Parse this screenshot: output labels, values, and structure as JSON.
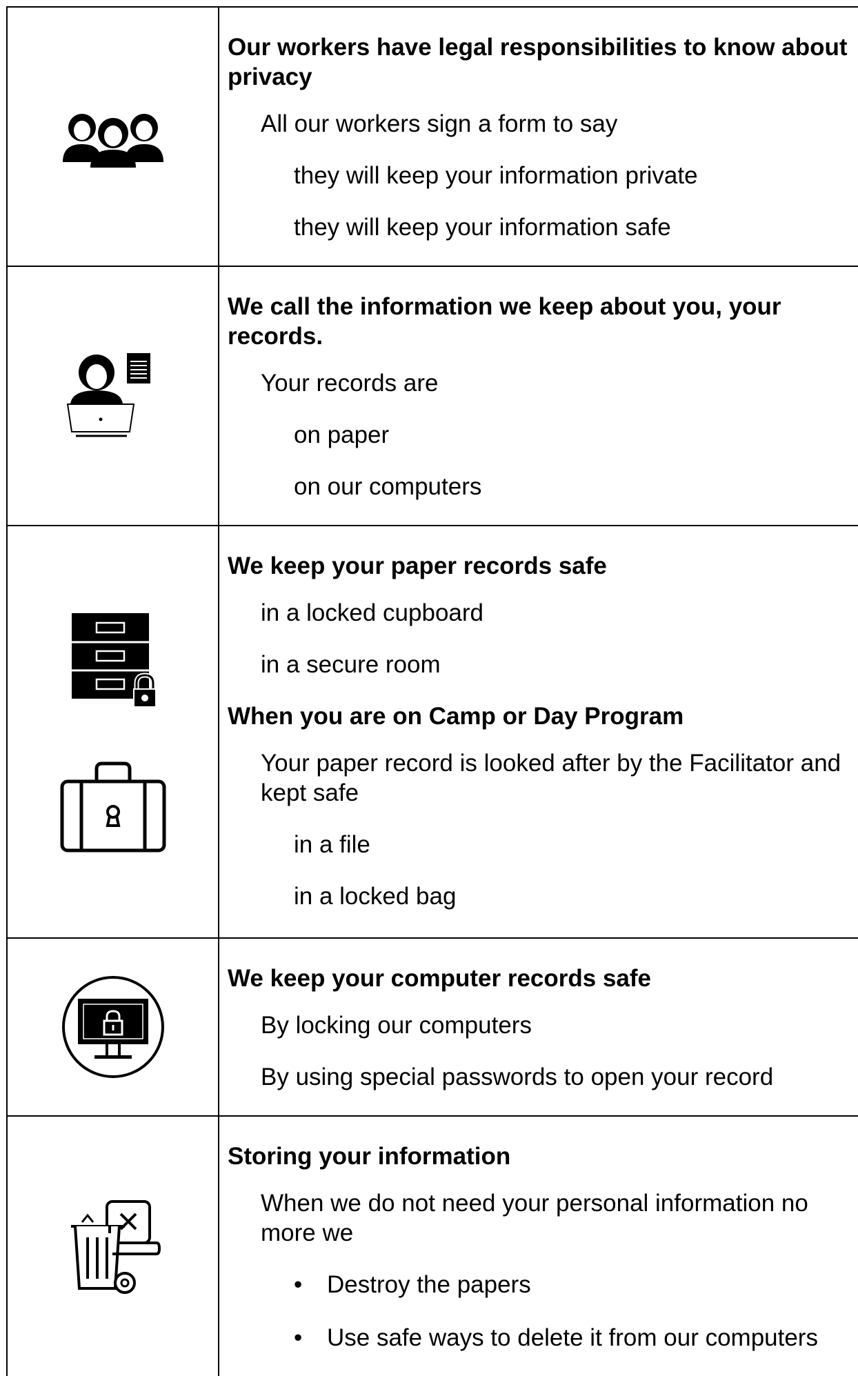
{
  "rows": [
    {
      "icon": "three-people-icon",
      "heading": "Our workers have legal responsibilities to know about privacy",
      "line1": "All our workers sign a form to say",
      "sub1": "they will keep your information private",
      "sub2": "they will keep your information safe"
    },
    {
      "icon": "person-at-laptop-with-document-icon",
      "heading": "We call the information we keep about you, your records.",
      "line1": "Your records are",
      "sub1": "on paper",
      "sub2": "on our computers"
    },
    {
      "icons": [
        "locked-filing-cabinet-icon",
        "locked-suitcase-icon"
      ],
      "heading1": "We keep your paper records safe",
      "line1": "in a locked cupboard",
      "line2": "in a secure room",
      "heading2": "When you are on Camp or Day Program",
      "line3": "Your paper record is looked after by the Facilitator and kept safe",
      "sub1": "in a file",
      "sub2": "in a locked bag"
    },
    {
      "icon": "locked-computer-icon",
      "heading": "We keep your computer records safe",
      "line1": "By locking our computers",
      "line2": "By using special passwords to open your record"
    },
    {
      "icon": "bin-with-document-icon",
      "heading": "Storing your information",
      "line1": "When we do not need your personal information no more we",
      "bullet_glyph": "•",
      "bullets": [
        "Destroy the papers",
        "Use safe ways to delete it from our computers"
      ]
    }
  ]
}
